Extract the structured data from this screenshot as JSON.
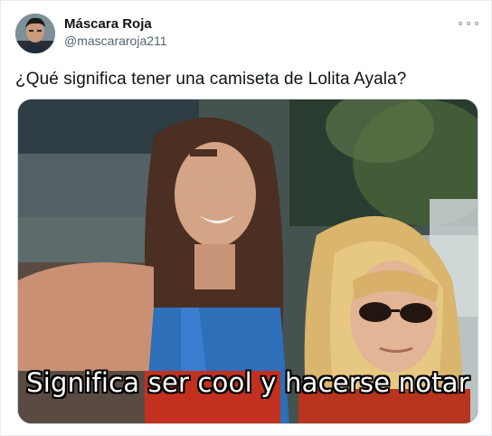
{
  "user": {
    "name": "Máscara Roja",
    "handle": "@mascararoja211"
  },
  "tweet": {
    "text": "¿Qué significa tener una camiseta de Lolita Ayala?"
  },
  "media": {
    "caption": "Significa ser cool y hacerse notar"
  },
  "icons": {
    "more": "more-options-icon",
    "avatar": "avatar"
  },
  "colors": {
    "name": "#0f1419",
    "secondary_text": "#536471",
    "border": "#cfd9de"
  }
}
